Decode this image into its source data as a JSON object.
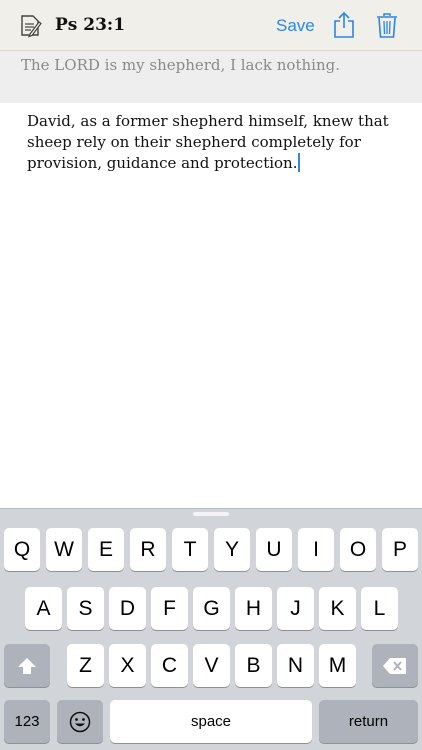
{
  "navbar": {
    "title": "Ps 23:1",
    "save_label": "Save",
    "icons": [
      "note-pencil-icon",
      "share-icon",
      "trash-icon"
    ],
    "accent_color": "#2b86e6"
  },
  "verse": {
    "text": "The LORD is my shepherd, I lack nothing."
  },
  "note": {
    "text": "David, as a former shepherd himself, knew that sheep rely on their shepherd completely for provision, guidance and protection."
  },
  "keyboard": {
    "row1": [
      "Q",
      "W",
      "E",
      "R",
      "T",
      "Y",
      "U",
      "I",
      "O",
      "P"
    ],
    "row2": [
      "A",
      "S",
      "D",
      "F",
      "G",
      "H",
      "J",
      "K",
      "L"
    ],
    "row3": [
      "Z",
      "X",
      "C",
      "V",
      "B",
      "N",
      "M"
    ],
    "numbers_label": "123",
    "space_label": "space",
    "return_label": "return",
    "icons": [
      "shift-icon",
      "backspace-icon",
      "emoji-icon"
    ]
  }
}
